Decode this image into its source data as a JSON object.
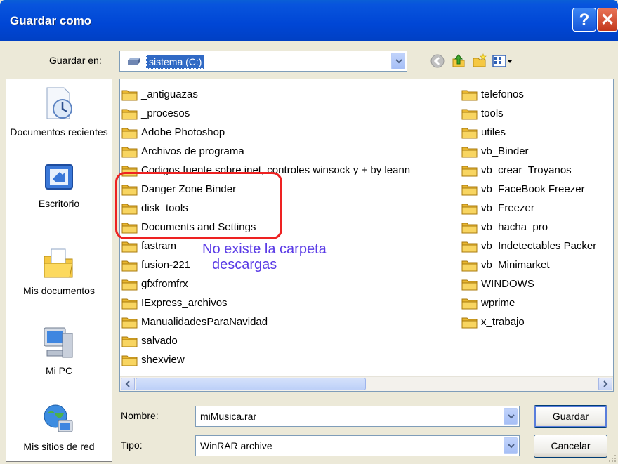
{
  "window": {
    "title": "Guardar como",
    "help_glyph": "?",
    "close_glyph": "✕"
  },
  "save_in": {
    "label": "Guardar en:",
    "value": "sistema (C:)"
  },
  "toolbar": {
    "icons": [
      "back-icon",
      "up-folder-icon",
      "new-folder-icon",
      "views-menu-icon"
    ]
  },
  "places": [
    {
      "label": "Documentos recientes",
      "icon": "recent-documents-icon"
    },
    {
      "label": "Escritorio",
      "icon": "desktop-icon"
    },
    {
      "label": "Mis documentos",
      "icon": "my-documents-icon"
    },
    {
      "label": "Mi PC",
      "icon": "my-computer-icon"
    },
    {
      "label": "Mis sitios de red",
      "icon": "network-places-icon"
    }
  ],
  "files": {
    "column1": [
      "_antiguazas",
      "_procesos",
      "Adobe Photoshop",
      "Archivos de programa",
      "Codigos fuente sobre inet, controles winsock y + by leann",
      "Danger Zone Binder",
      "disk_tools",
      "Documents and Settings",
      "fastram",
      "fusion-221",
      "gfxfromfrx",
      "IExpress_archivos",
      "ManualidadesParaNavidad",
      "salvado",
      "shexview"
    ],
    "column2": [
      "telefonos",
      "tools",
      "utiles",
      "vb_Binder",
      "vb_crear_Troyanos",
      "vb_FaceBook Freezer",
      "vb_Freezer",
      "vb_hacha_pro",
      "vb_Indetectables Packer",
      "vb_Minimarket",
      "WINDOWS",
      "wprime",
      "x_trabajo"
    ]
  },
  "annotation": {
    "line1": "No existe la carpeta",
    "line2": "descargas",
    "color": "#5A3BE6",
    "box_color": "#E22222"
  },
  "filename": {
    "label": "Nombre:",
    "value": "miMusica.rar"
  },
  "filetype": {
    "label": "Tipo:",
    "value": "WinRAR archive"
  },
  "buttons": {
    "save": "Guardar",
    "cancel": "Cancelar"
  },
  "colors": {
    "titlebar": "#0046D5",
    "window_bg": "#ECE9D8",
    "selection": "#316AC5"
  }
}
